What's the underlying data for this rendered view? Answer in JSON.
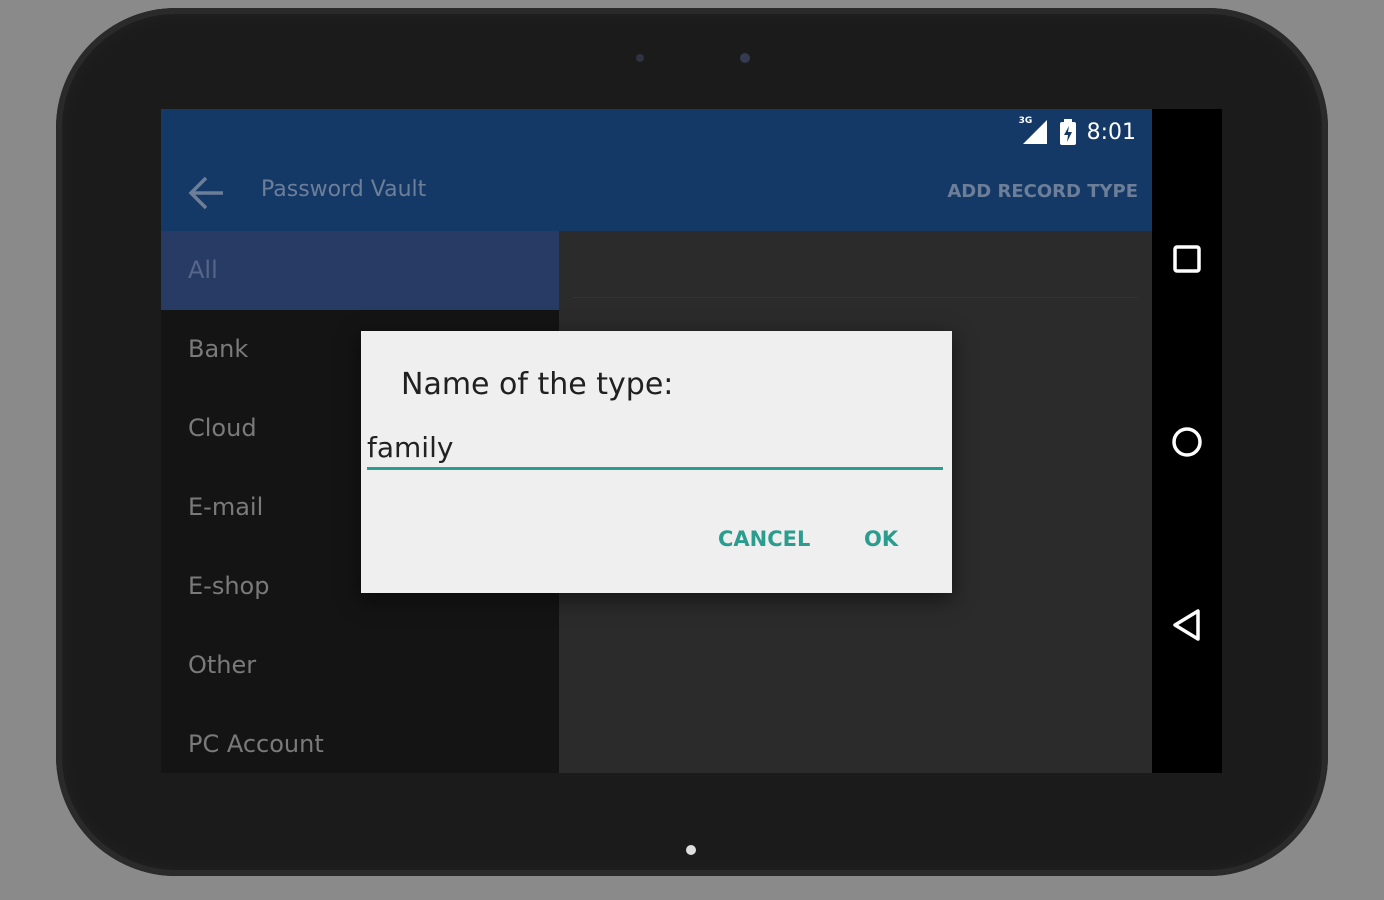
{
  "status_bar": {
    "network_label": "3G",
    "time": "8:01"
  },
  "action_bar": {
    "title": "Password Vault",
    "action_label": "ADD RECORD TYPE"
  },
  "sidebar": {
    "items": [
      {
        "label": "All",
        "selected": true
      },
      {
        "label": "Bank",
        "selected": false
      },
      {
        "label": "Cloud",
        "selected": false
      },
      {
        "label": "E-mail",
        "selected": false
      },
      {
        "label": "E-shop",
        "selected": false
      },
      {
        "label": "Other",
        "selected": false
      },
      {
        "label": "PC Account",
        "selected": false
      }
    ]
  },
  "dialog": {
    "title": "Name of the type:",
    "input_value": "family",
    "cancel_label": "CANCEL",
    "ok_label": "OK"
  },
  "colors": {
    "toolbar": "#153966",
    "selected_item": "#283b64",
    "accent": "#2a9d8f",
    "dialog_bg": "#efefef"
  },
  "icons": {
    "back": "arrow-left-icon",
    "recents": "square-icon",
    "home": "circle-icon",
    "nav_back": "triangle-left-icon",
    "signal": "signal-icon",
    "battery": "battery-icon"
  }
}
